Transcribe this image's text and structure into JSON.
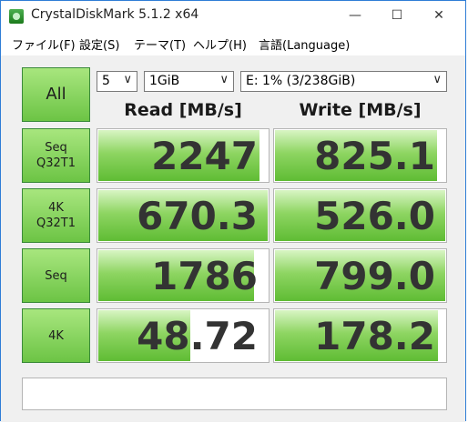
{
  "window": {
    "title": "CrystalDiskMark 5.1.2 x64",
    "controls": {
      "minimize": "—",
      "maximize": "☐",
      "close": "✕"
    }
  },
  "menu": [
    "ファイル(F)",
    "設定(S)",
    "テーマ(T)",
    "ヘルプ(H)",
    "言語(Language)"
  ],
  "toolbar": {
    "all_label": "All",
    "count": "5",
    "size": "1GiB",
    "drive": "E: 1% (3/238GiB)"
  },
  "headers": {
    "read": "Read [MB/s]",
    "write": "Write [MB/s]"
  },
  "tests": [
    {
      "line1": "Seq",
      "line2": "Q32T1",
      "read": "2247",
      "write": "825.1",
      "read_fill": 0.95,
      "write_fill": 0.95
    },
    {
      "line1": "4K",
      "line2": "Q32T1",
      "read": "670.3",
      "write": "526.0",
      "read_fill": 1.0,
      "write_fill": 1.0
    },
    {
      "line1": "Seq",
      "line2": "",
      "read": "1786",
      "write": "799.0",
      "read_fill": 0.92,
      "write_fill": 1.0
    },
    {
      "line1": "4K",
      "line2": "",
      "read": "48.72",
      "write": "178.2",
      "read_fill": 0.55,
      "write_fill": 0.96
    }
  ],
  "comment": "",
  "colors": {
    "accent_border": "#2f7dd6",
    "bar_green": "#6cc445"
  }
}
